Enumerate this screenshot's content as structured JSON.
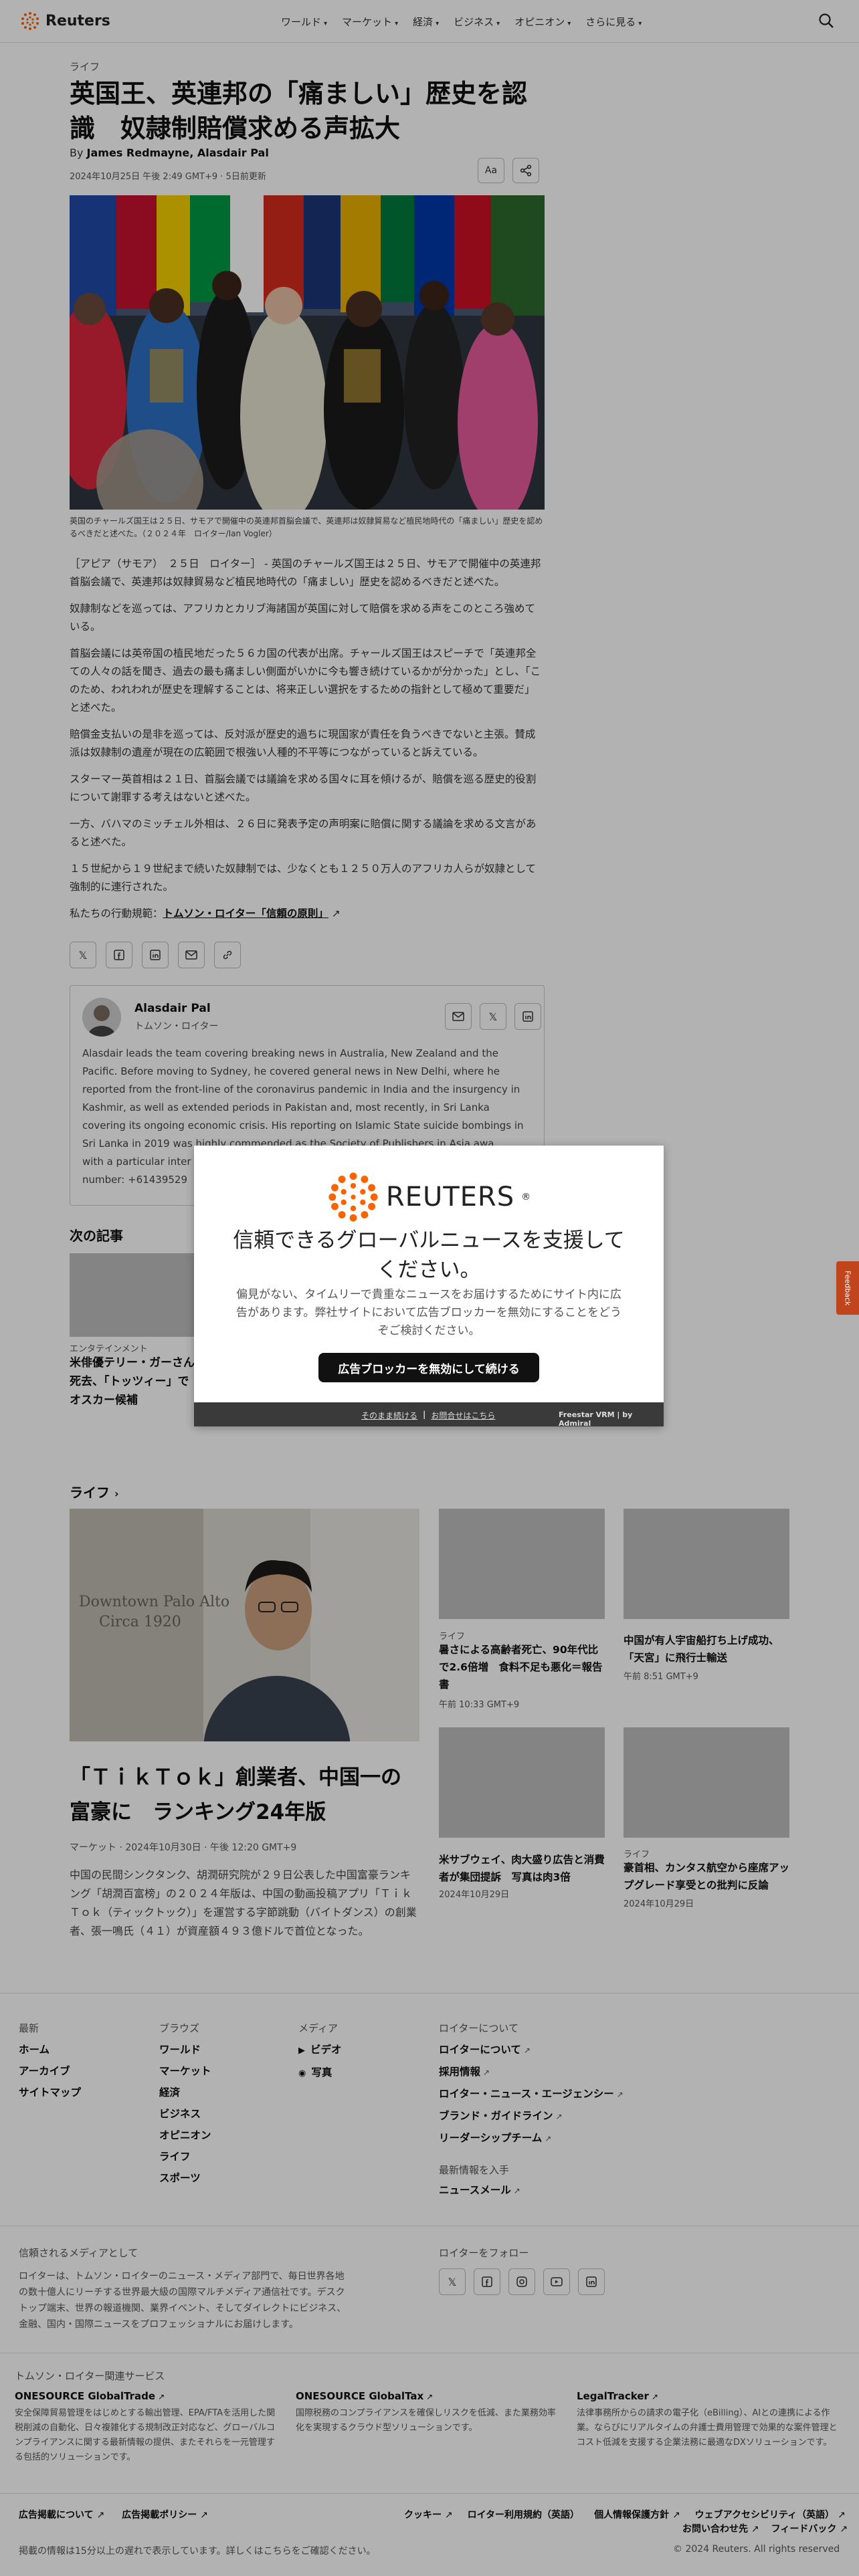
{
  "header": {
    "logo_text": "Reuters",
    "nav": [
      "ワールド",
      "マーケット",
      "経済",
      "ビジネス",
      "オピニオン",
      "さらに見る"
    ]
  },
  "article": {
    "category": "ライフ",
    "title": "英国王、英連邦の「痛ましい」歴史を認識　奴隷制賠償求める声拡大",
    "byline_prefix": "By",
    "authors": "James Redmayne, Alasdair Pal",
    "date": "2024年10月25日 午後 2:49 GMT+9 · 5日前更新",
    "text_size_label": "Aa",
    "caption": "英国のチャールズ国王は２５日、サモアで開催中の英連邦首脳会議で、英連邦は奴隷貿易など植民地時代の「痛ましい」歴史を認めるべきだと述べた。（２０２４年　ロイター/Ian Vogler）",
    "paragraphs": [
      "［アピア（サモア）　２５日　ロイター］ - 英国のチャールズ国王は２５日、サモアで開催中の英連邦首脳会議で、英連邦は奴隷貿易など植民地時代の「痛ましい」歴史を認めるべきだと述べた。",
      "奴隷制などを巡っては、アフリカとカリブ海諸国が英国に対して賠償を求める声をこのところ強めている。",
      "首脳会議には英帝国の植民地だった５６カ国の代表が出席。チャールズ国王はスピーチで「英連邦全ての人々の話を聞き、過去の最も痛ましい側面がいかに今も響き続けているかが分かった」とし、「このため、われわれが歴史を理解することは、将来正しい選択をするための指針として極めて重要だ」と述べた。",
      "賠償金支払いの是非を巡っては、反対派が歴史的過ちに現国家が責任を負うべきでないと主張。賛成派は奴隷制の遺産が現在の広範囲で根強い人種的不平等につながっていると訴えている。",
      "スターマー英首相は２１日、首脳会議では議論を求める国々に耳を傾けるが、賠償を巡る歴史的役割について謝罪する考えはないと述べた。",
      "一方、バハマのミッチェル外相は、２６日に発表予定の声明案に賠償に関する議論を求める文言があると述べた。",
      "１５世紀から１９世紀まで続いた奴隷制では、少なくとも１２５０万人のアフリカ人らが奴隷として強制的に連行された。"
    ],
    "principles_prefix": "私たちの行動規範：",
    "principles_link": "トムソン・ロイター「信頼の原則」"
  },
  "author_box": {
    "name": "Alasdair Pal",
    "role": "トムソン・ロイター",
    "bio": "Alasdair leads the team covering breaking news in Australia, New Zealand and the Pacific. Before moving to Sydney, he covered general news in New Delhi, where he reported from the front-line of the coronavirus pandemic in India and the insurgency in Kashmir, as well as extended periods in Pakistan and, most recently, in Sri Lanka covering its ongoing economic crisis. His reporting on Islamic State suicide bombings in Sri Lanka in 2019 was highly commended as the Society of Publishers in Asia awa",
    "bio_tail": "with a particular inter",
    "bio_number": "number: +61439529"
  },
  "next": {
    "heading": "次の記事",
    "category": "エンタテインメント",
    "title": "米俳優テリー・ガーさん死去、「トッツィー」でオスカー候補"
  },
  "life_section": {
    "heading": "ライフ",
    "lead": {
      "title": "「ＴｉｋＴｏｋ」創業者、中国一の富豪に　ランキング24年版",
      "meta": "マーケット · 2024年10月30日 · 午後 12:20 GMT+9",
      "desc": "中国の民間シンクタンク、胡潤研究院が２９日公表した中国富豪ランキング「胡潤百富榜」の２０２４年版は、中国の動画投稿アプリ「ＴｉｋＴｏｋ（ティックトック）」を運営する字節跳動（バイトダンス）の創業者、張一鳴氏（４１）が資産額４９３億ドルで首位となった。",
      "sign_text_1": "Downtown Palo Alto",
      "sign_text_2": "Circa 1920"
    },
    "tiles": [
      {
        "category": "ライフ",
        "title": "暑さによる高齢者死亡、90年代比で2.6倍増　食料不足も悪化＝報告書",
        "time": "午前 10:33 GMT+9"
      },
      {
        "category": "",
        "title": "中国が有人宇宙船打ち上げ成功、「天宮」に飛行士輸送",
        "time": "午前 8:51 GMT+9"
      },
      {
        "category": "",
        "title": "米サブウェイ、肉大盛り広告と消費者が集団提訴　写真は肉3倍",
        "time": "2024年10月29日"
      },
      {
        "category": "ライフ",
        "title": "豪首相、カンタス航空から座席アップグレード享受との批判に反論",
        "time": "2024年10月29日"
      }
    ]
  },
  "footer": {
    "cols": [
      {
        "heading": "最新",
        "links": [
          "ホーム",
          "アーカイブ",
          "サイトマップ"
        ]
      },
      {
        "heading": "ブラウズ",
        "links": [
          "ワールド",
          "マーケット",
          "経済",
          "ビジネス",
          "オピニオン",
          "ライフ",
          "スポーツ"
        ]
      },
      {
        "heading": "メディア",
        "links": [
          "ビデオ",
          "写真"
        ]
      },
      {
        "heading": "ロイターについて",
        "links": [
          "ロイターについて",
          "採用情報",
          "ロイター・ニュース・エージェンシー",
          "ブランド・ガイドライン",
          "リーダーシップチーム"
        ]
      }
    ],
    "newsletter_heading": "最新情報を入手",
    "newsletter_link": "ニュースメール",
    "trusted_heading": "信頼されるメディアとして",
    "trusted_text": "ロイターは、トムソン・ロイターのニュース・メディア部門で、毎日世界各地の数十億人にリーチする世界最大級の国際マルチメディア通信社です。デスクトップ端末、世界の報道機関、業界イベント、そしてダイレクトにビジネス、金融、国内・国際ニュースをプロフェッショナルにお届けします。",
    "follow_heading": "ロイターをフォロー",
    "tr_heading": "トムソン・ロイター関連サービス",
    "services": [
      {
        "name": "ONESOURCE GlobalTrade",
        "desc": "安全保障貿易管理をはじめとする輸出管理、EPA/FTAを活用した関税削減の自動化、日々複雑化する規制改正対応など、グローバルコンプライアンスに関する最新情報の提供、またそれらを一元管理する包括的ソリューションです。"
      },
      {
        "name": "ONESOURCE GlobalTax",
        "desc": "国際税務のコンプライアンスを確保しリスクを低減、また業務効率化を実現するクラウド型ソリューションです。"
      },
      {
        "name": "LegalTracker",
        "desc": "法律事務所からの請求の電子化（eBilling）、AIとの連携による作業。ならびにリアルタイムの弁護士費用管理で効果的な案件管理とコスト低減を支援する企業法務に最適なDXソリューションです。"
      }
    ],
    "bottom_left": [
      "広告掲載について",
      "広告掲載ポリシー"
    ],
    "bottom_right": [
      "クッキー",
      "ロイター利用規約（英語）",
      "個人情報保護方針",
      "ウェブアクセシビリティ（英語）"
    ],
    "contact_link": "お問い合わせ先",
    "feedback_link": "フィードバック",
    "disclaimer": "掲載の情報は15分以上の遅れで表示しています。詳しくはこちらをご確認ください。",
    "copyright": "© 2024 Reuters. All rights reserved"
  },
  "modal": {
    "logo_text": "REUTERS",
    "title": "信頼できるグローバルニュースを支援してください。",
    "desc": "偏見がない、タイムリーで貴重なニュースをお届けするためにサイト内に広告があります。弊社サイトにおいて広告ブロッカーを無効にすることをどうぞご検討ください。",
    "button": "広告ブロッカーを無効にして続ける",
    "link1": "そのまま続ける",
    "link2": "お問合せはこちら",
    "brand": "Freestar VRM | by Admiral"
  },
  "feedback_tab": "Feedback",
  "colors": {
    "accent": "#fa6400",
    "overlay": "rgba(0,0,0,0.3)",
    "modal_bar": "#3a3a3a"
  }
}
